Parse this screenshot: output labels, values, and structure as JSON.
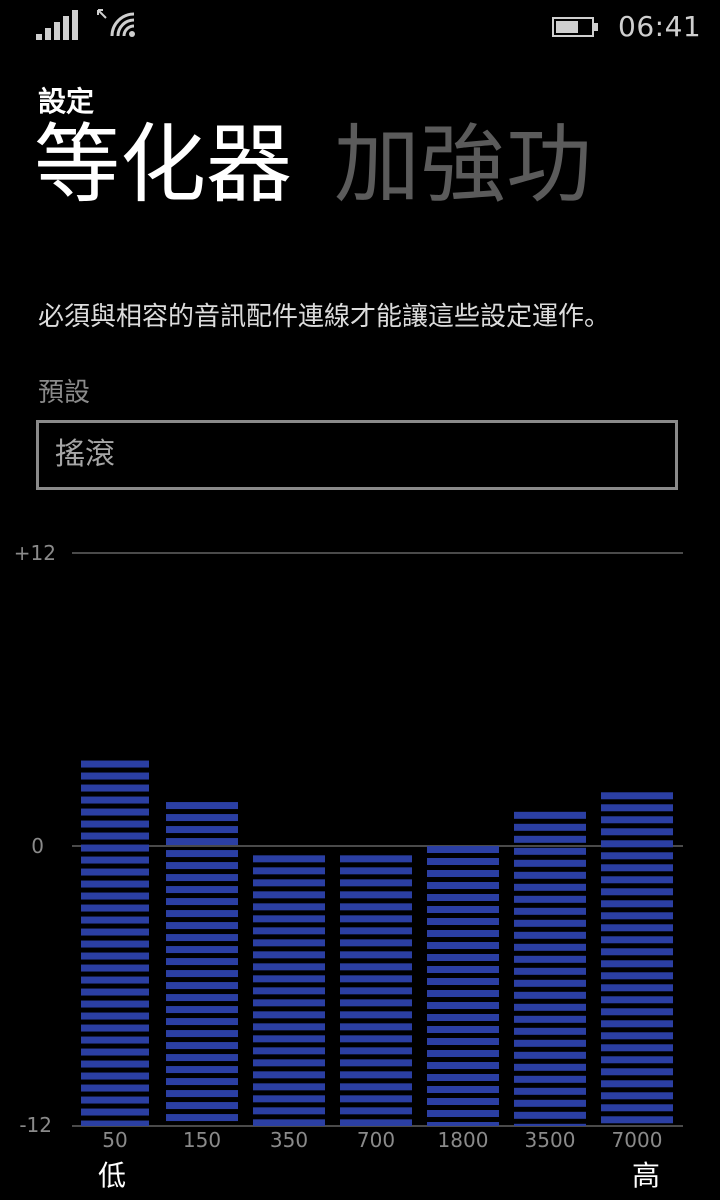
{
  "status_bar": {
    "time": "06:41",
    "icons": [
      "signal-icon",
      "roaming-icon",
      "wifi-icon",
      "battery-icon"
    ]
  },
  "header": {
    "app_title": "設定",
    "tabs": [
      {
        "label": "等化器",
        "active": true
      },
      {
        "label": "加強功",
        "active": false
      }
    ]
  },
  "notice": "必須與相容的音訊配件連線才能讓這些設定運作。",
  "preset": {
    "label": "預設",
    "value": "搖滾"
  },
  "colors": {
    "bar": "#2b3fa3",
    "gridline": "#4a4a4a",
    "muted_text": "#8a8a8a"
  },
  "chart_data": {
    "type": "bar",
    "categories": [
      "50",
      "150",
      "350",
      "700",
      "1800",
      "3500",
      "7000"
    ],
    "values": [
      3.5,
      1.8,
      -0.4,
      -0.4,
      0.0,
      1.4,
      2.2
    ],
    "ylim": [
      -12,
      12
    ],
    "y_tick_labels": [
      "+12",
      "0",
      "-12"
    ],
    "low_label": "低",
    "high_label": "高",
    "grid": true
  }
}
